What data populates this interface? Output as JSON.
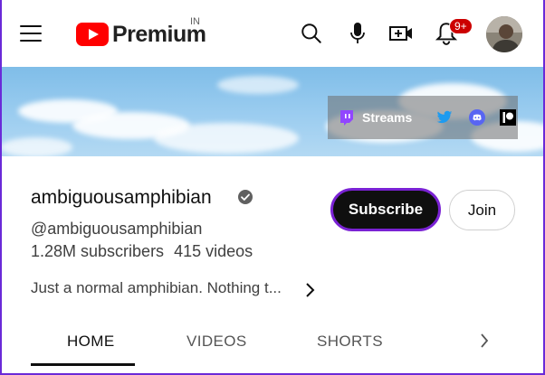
{
  "header": {
    "logo_text": "Premium",
    "region": "IN",
    "notification_count": "9+",
    "icons": [
      "menu-icon",
      "youtube-logo-icon",
      "search-icon",
      "microphone-icon",
      "create-video-icon",
      "bell-icon",
      "avatar"
    ]
  },
  "banner": {
    "streams_label": "Streams",
    "link_icons": [
      "twitch-icon",
      "twitter-icon",
      "discord-icon",
      "patreon-icon"
    ]
  },
  "channel": {
    "name": "ambiguousamphibian",
    "handle": "@ambiguousamphibian",
    "subscribers": "1.28M subscribers",
    "videos": "415 videos",
    "description": "Just a normal amphibian. Nothing t...",
    "subscribe_label": "Subscribe",
    "join_label": "Join"
  },
  "tabs": [
    {
      "label": "HOME",
      "active": true
    },
    {
      "label": "VIDEOS",
      "active": false
    },
    {
      "label": "SHORTS",
      "active": false
    }
  ],
  "colors": {
    "brand_red": "#ff0000",
    "subscribe_outline": "#7a22d4",
    "frame": "#6a2ad8"
  }
}
